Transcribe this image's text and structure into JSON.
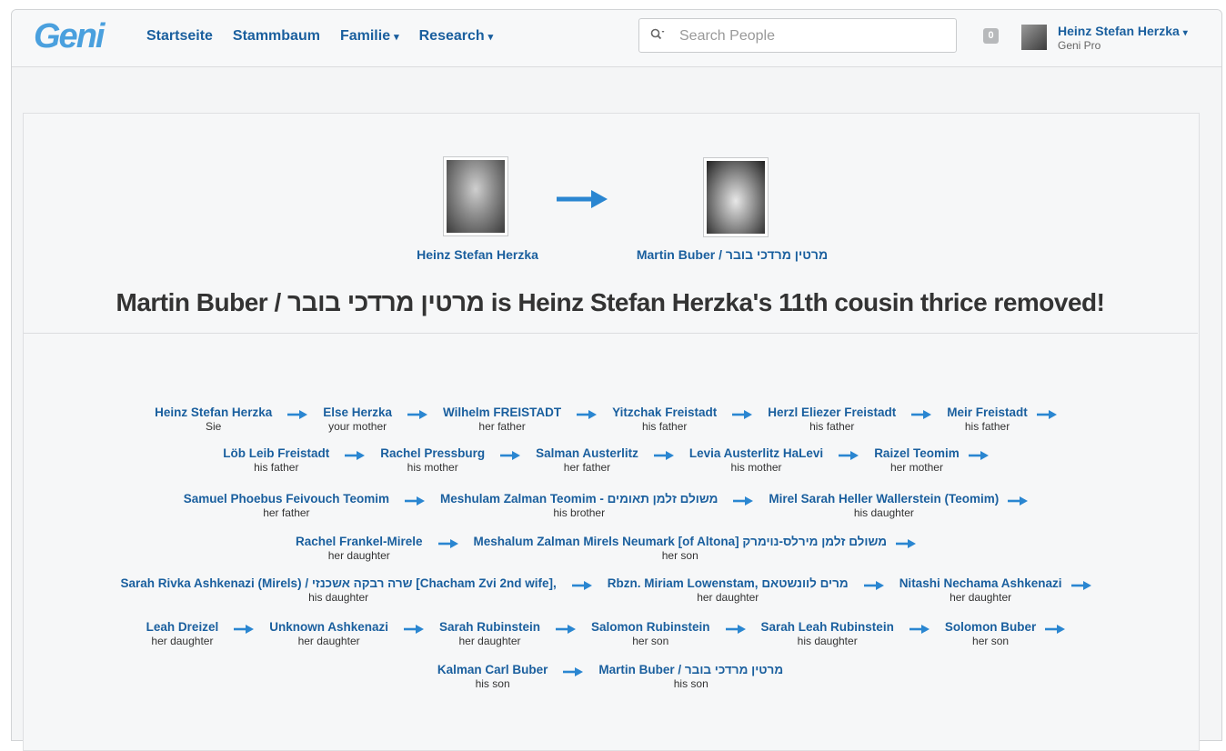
{
  "header": {
    "logo": "Geni",
    "nav": [
      {
        "label": "Startseite",
        "dropdown": false
      },
      {
        "label": "Stammbaum",
        "dropdown": false
      },
      {
        "label": "Familie",
        "dropdown": true
      },
      {
        "label": "Research",
        "dropdown": true
      }
    ],
    "search_placeholder": "Search People",
    "notification_count": "0",
    "user_name": "Heinz Stefan Herzka",
    "user_plan": "Geni Pro"
  },
  "relationship": {
    "from_name": "Heinz Stefan Herzka",
    "to_name": "Martin Buber / מרטין מרדכי בובר",
    "headline": "Martin Buber / מרטין מרדכי בובר is Heinz Stefan Herzka's 11th cousin thrice removed!"
  },
  "chain": [
    [
      {
        "name": "Heinz Stefan Herzka",
        "relation": "Sie"
      },
      {
        "name": "Else Herzka",
        "relation": "your mother"
      },
      {
        "name": "Wilhelm FREISTADT",
        "relation": "her father"
      },
      {
        "name": "Yitzchak Freistadt",
        "relation": "his father"
      },
      {
        "name": "Herzl Eliezer Freistadt",
        "relation": "his father"
      },
      {
        "name": "Meir Freistadt",
        "relation": "his father"
      }
    ],
    [
      {
        "name": "Löb Leib Freistadt",
        "relation": "his father"
      },
      {
        "name": "Rachel Pressburg",
        "relation": "his mother"
      },
      {
        "name": "Salman Austerlitz",
        "relation": "her father"
      },
      {
        "name": "Levia Austerlitz HaLevi",
        "relation": "his mother"
      },
      {
        "name": "Raizel Teomim",
        "relation": "her mother"
      }
    ],
    [
      {
        "name": "Samuel Phoebus Feivouch Teomim",
        "relation": "her father"
      },
      {
        "name": "Meshulam Zalman Teomim - משולם זלמן תאומים",
        "relation": "his brother"
      },
      {
        "name": "Mirel Sarah Heller Wallerstein (Teomim)",
        "relation": "his daughter"
      }
    ],
    [
      {
        "name": "Rachel Frankel-Mirele",
        "relation": "her daughter"
      },
      {
        "name": "Meshalum Zalman Mirels Neumark [of Altona] משולם זלמן מירלס-נוימרק",
        "relation": "her son"
      }
    ],
    [
      {
        "name": "Sarah Rivka Ashkenazi (Mirels) / שרה רבקה אשכנזי [Chacham Zvi 2nd wife],",
        "relation": "his daughter"
      },
      {
        "name": "Rbzn. Miriam Lowenstam, מרים לוונשטאם",
        "relation": "her daughter"
      },
      {
        "name": "Nitashi Nechama Ashkenazi",
        "relation": "her daughter"
      }
    ],
    [
      {
        "name": "Leah Dreizel",
        "relation": "her daughter"
      },
      {
        "name": "Unknown Ashkenazi",
        "relation": "her daughter"
      },
      {
        "name": "Sarah Rubinstein",
        "relation": "her daughter"
      },
      {
        "name": "Salomon Rubinstein",
        "relation": "her son"
      },
      {
        "name": "Sarah Leah Rubinstein",
        "relation": "his daughter"
      },
      {
        "name": "Solomon Buber",
        "relation": "her son"
      }
    ],
    [
      {
        "name": "Kalman Carl Buber",
        "relation": "his son"
      },
      {
        "name": "Martin Buber / מרטין מרדכי בובר",
        "relation": "his son"
      }
    ]
  ],
  "colors": {
    "link": "#1a5f9e",
    "arrow": "#2a86d1",
    "logo": "#4aa0de"
  }
}
